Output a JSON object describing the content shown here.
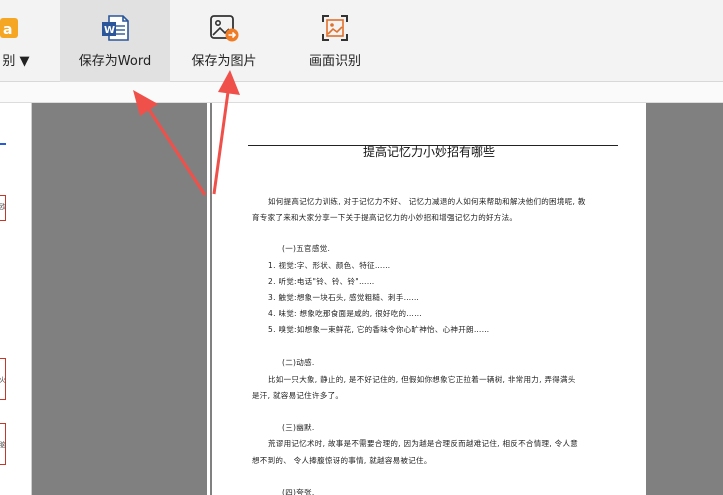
{
  "toolbar": {
    "partial_label": "别 ▼",
    "save_word_label": "保存为Word",
    "save_image_label": "保存为图片",
    "screen_recognition_label": "画面识别"
  },
  "left_strip": {
    "glyphs": [
      "欧",
      "火",
      "脑"
    ]
  },
  "document": {
    "title": "提高记忆力小妙招有哪些",
    "lines": [
      "如何提高记忆力训练, 对于记忆力不好、 记忆力减退的人如何来帮助和解决他们的困境呢, 教",
      "育专家了来和大家分享一下关于提高记忆力的小妙招和增强记忆力的好方法。",
      "(一)五官感觉.",
      "1. 视觉:字、形状、颜色、特征……",
      "2. 听觉:电话\"铃、铃、铃\"……",
      "3. 触觉:想象一块石头, 感觉粗糙、刺手……",
      "4. 味觉: 想象吃那食面是咸的, 很好吃的……",
      "5. 嗅觉:如想象一束鲜花, 它的香味令你心旷神怡、心神开朗……",
      "(二)动感.",
      "比如一只大象, 静止的, 是不好记住的, 但假如你想象它正拉着一辆树, 非常用力, 弄得满头",
      "是汗, 就容易记住许多了。",
      "(三)幽默.",
      "荒谬用记忆术时, 故事是不需要合理的, 因为越是合理反而越难记住, 相反不合情理, 令人意",
      "想不到的、 令人捧腹惊讶的事情, 就越容易被记住。",
      "(四)夸张."
    ]
  },
  "colors": {
    "arrow": "#f0504a",
    "word_blue": "#2b579a",
    "image_orange": "#f07d26",
    "recognition_orange": "#e0702a",
    "doc_gray": "#808080"
  }
}
